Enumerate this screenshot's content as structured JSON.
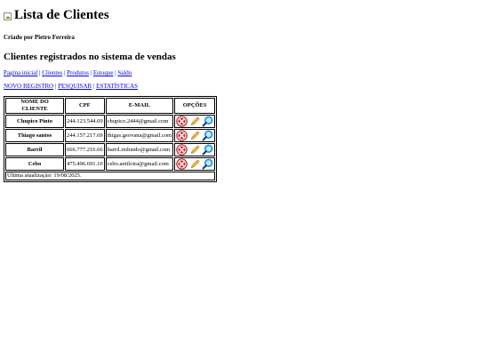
{
  "page": {
    "title": "Lista de Clientes",
    "author": "Criado por Pietro Ferreira",
    "subtitle": "Clientes registrados no sistema de vendas"
  },
  "nav": [
    "Pagina inicial",
    "Clientes",
    "Produtos",
    "Estoque",
    "Saldo"
  ],
  "actions": [
    "NOVO REGISTRO",
    "PESQUISAR",
    "ESTATÍSTICAS"
  ],
  "table": {
    "headers": [
      "NOME DO CLIENTE",
      "CPF",
      "E-MAIL",
      "OPÇÕES"
    ],
    "rows": [
      {
        "name": "Chupico Pinto",
        "cpf": "244.123.544.69",
        "email": "chupico.2444@gmail.com"
      },
      {
        "name": "Thiago santos",
        "cpf": "244.157.217.69",
        "email": "thigas.geovana@gmail.com"
      },
      {
        "name": "Barril",
        "cpf": "666.777.216.66",
        "email": "barril.redondo@gmail.com"
      },
      {
        "name": "Cebo",
        "cpf": "475.496.691.10",
        "email": "cebo.antiloira@gmail.com"
      }
    ],
    "footer": "Última atualização: 19/08/2025."
  },
  "icons": {
    "delete": "delete-icon",
    "edit": "pencil-icon",
    "view": "magnifier-icon"
  },
  "colors": {
    "link": "#0000ee",
    "delete": "#d9232a",
    "pencil": "#f0b429",
    "magnifier": "#1e90d6"
  }
}
